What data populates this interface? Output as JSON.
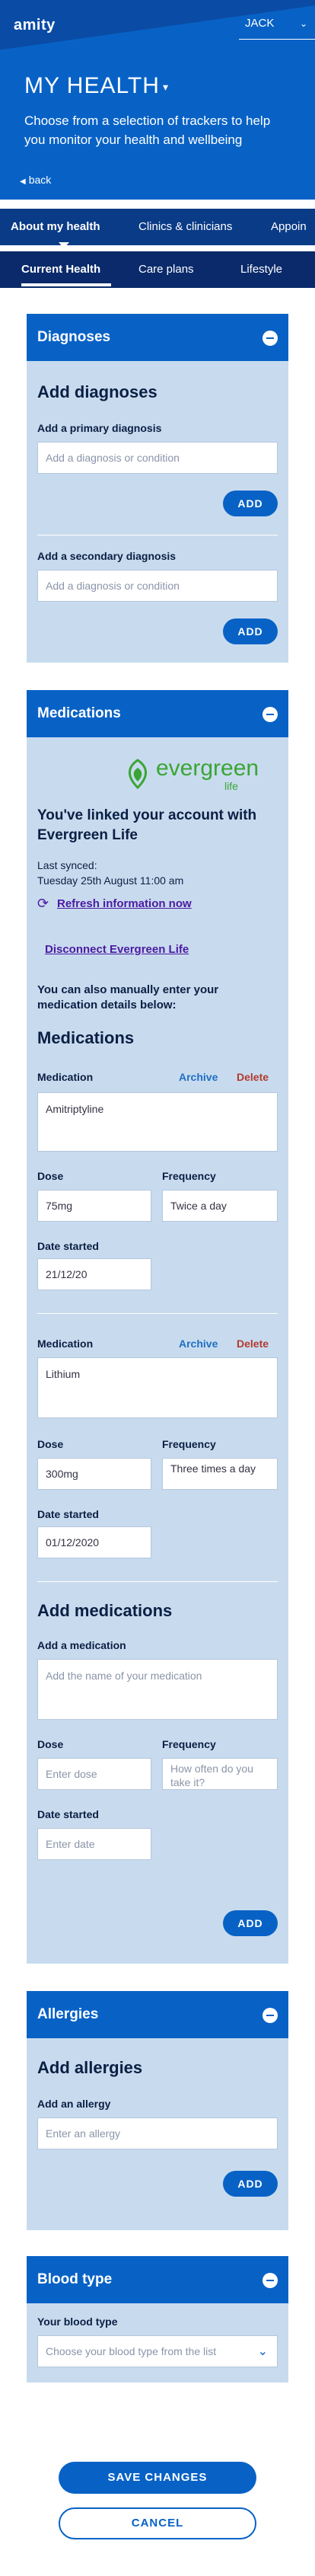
{
  "header": {
    "logo": "amity",
    "user": "JACK",
    "title": "MY HEALTH",
    "subtitle": "Choose from a selection of trackers to help you monitor your health and wellbeing",
    "back": "back"
  },
  "tabs_primary": [
    "About my health",
    "Clinics & clinicians",
    "Appoin"
  ],
  "tabs_secondary": [
    "Current Health",
    "Care plans",
    "Lifestyle"
  ],
  "diagnoses": {
    "title": "Diagnoses",
    "heading": "Add diagnoses",
    "primary_label": "Add a primary diagnosis",
    "primary_placeholder": "Add a diagnosis or condition",
    "secondary_label": "Add a secondary diagnosis",
    "secondary_placeholder": "Add a diagnosis or condition",
    "add": "ADD"
  },
  "medications": {
    "title": "Medications",
    "brand_name": "evergreen",
    "brand_sub": "life",
    "linked_text": "You've linked your account with Evergreen Life",
    "last_synced_label": "Last synced:",
    "last_synced_value": "Tuesday 25th August 11:00 am",
    "refresh": "Refresh information now",
    "disconnect": "Disconnect Evergreen Life",
    "manual_text": "You can also manually enter your medication details below:",
    "list_heading": "Medications",
    "medication_label": "Medication",
    "archive": "Archive",
    "delete": "Delete",
    "dose_label": "Dose",
    "frequency_label": "Frequency",
    "date_label": "Date started",
    "items": [
      {
        "name": "Amitriptyline",
        "dose": "75mg",
        "frequency": "Twice a day",
        "date": "21/12/20"
      },
      {
        "name": "Lithium",
        "dose": "300mg",
        "frequency": "Three times a day",
        "date": "01/12/2020"
      }
    ],
    "add_heading": "Add medications",
    "add_label": "Add a medication",
    "add_placeholder": "Add the name of your medication",
    "dose_placeholder": "Enter dose",
    "frequency_placeholder": "How often do you take it?",
    "date_placeholder": "Enter date",
    "add": "ADD"
  },
  "allergies": {
    "title": "Allergies",
    "heading": "Add allergies",
    "label": "Add an allergy",
    "placeholder": "Enter an allergy",
    "add": "ADD"
  },
  "blood_type": {
    "title": "Blood type",
    "label": "Your blood type",
    "placeholder": "Choose your blood type from the list"
  },
  "actions": {
    "save": "SAVE CHANGES",
    "cancel": "CANCEL"
  },
  "colors": {
    "primary": "#0862c6",
    "card_bg": "#c8dbee",
    "nav_dark": "#0a2a6b",
    "delete": "#b23a2f",
    "link_purple": "#4b1aa3",
    "brand_green": "#3aa535"
  }
}
